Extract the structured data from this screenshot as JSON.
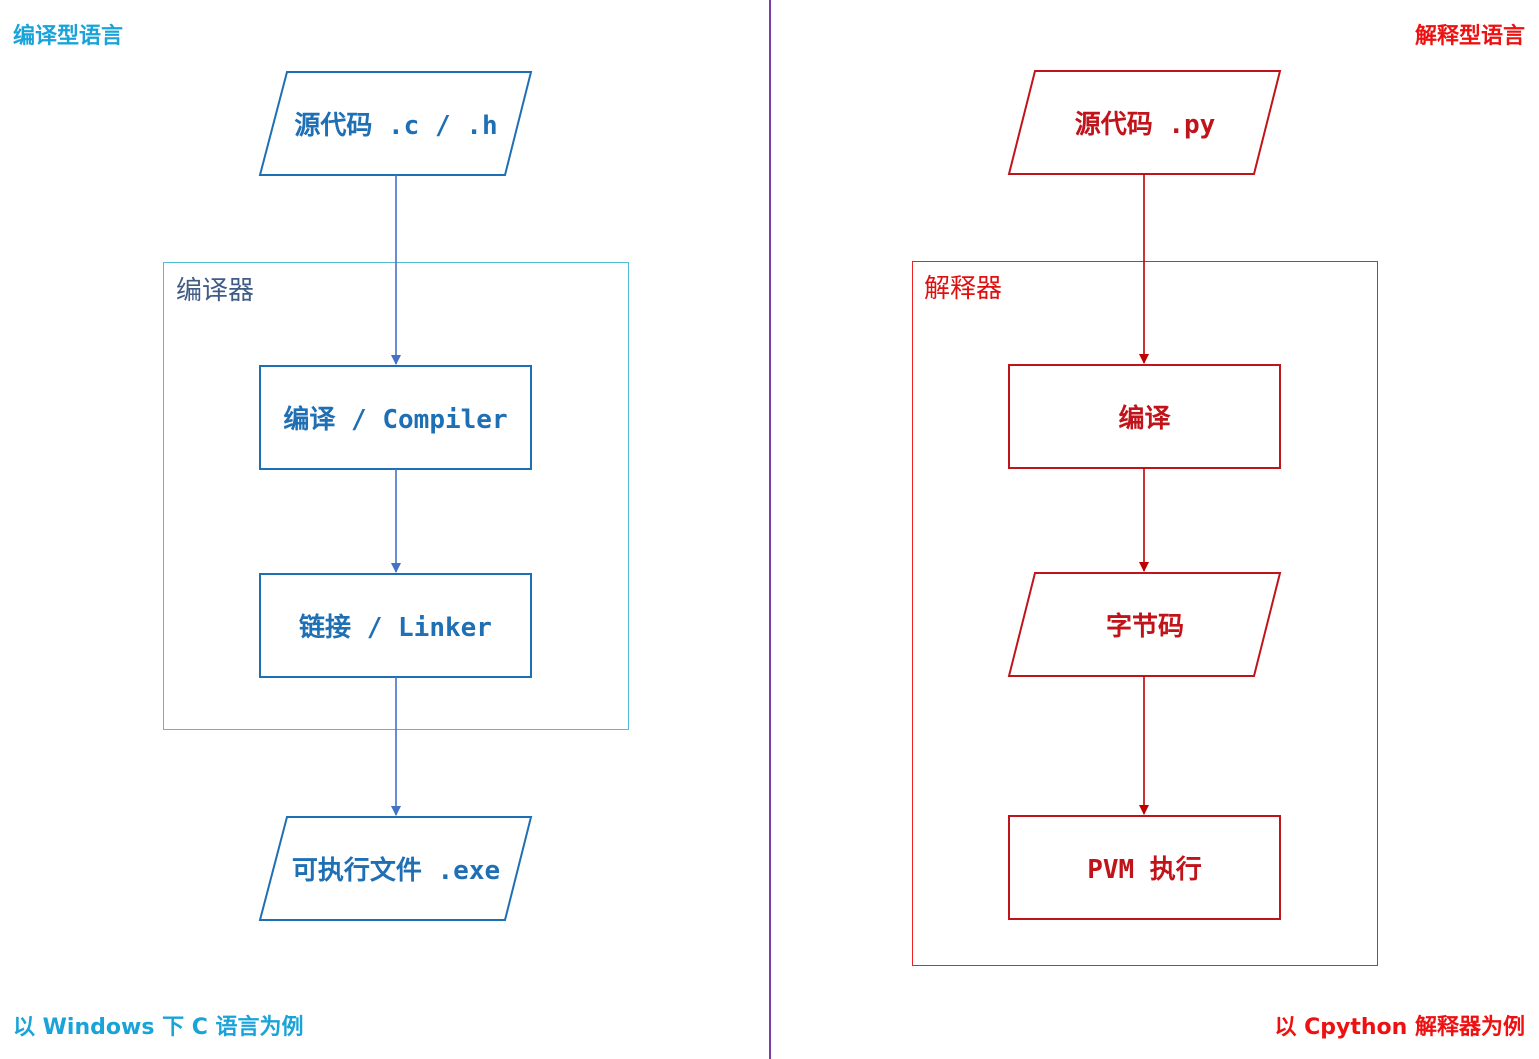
{
  "left": {
    "corner_top": "编译型语言",
    "corner_bottom": "以 Windows 下 C 语言为例",
    "group_label": "编译器",
    "nodes": {
      "source": "源代码 .c / .h",
      "compile": "编译 / Compiler",
      "link": "链接 / Linker",
      "output": "可执行文件 .exe"
    },
    "color": "#1f6fb5"
  },
  "right": {
    "corner_top": "解释型语言",
    "corner_bottom": "以 Cpython 解释器为例",
    "group_label": "解释器",
    "nodes": {
      "source": "源代码 .py",
      "compile": "编译",
      "bytecode": "字节码",
      "execute": "PVM 执行"
    },
    "color": "#c0141a"
  },
  "colors": {
    "left_arrow": "#4472c4",
    "right_arrow": "#c00000",
    "divider": "#7a3fa3"
  }
}
